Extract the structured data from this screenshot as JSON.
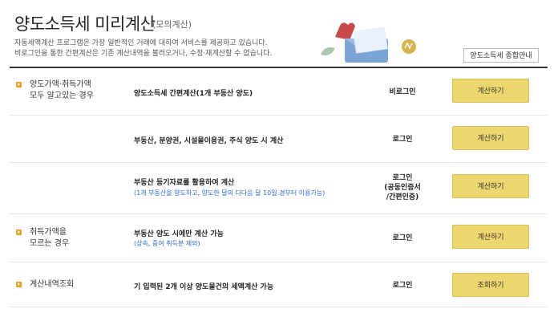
{
  "header": {
    "title": "양도소득세 미리계산",
    "subtitle": "(모의계산)",
    "desc_line1": "자동세액계산 프로그램은 가장 일반적인 거래에 대하여 서비스를 제공하고 있습니다.",
    "desc_line2": "비로그인을 통한 간편계산은 기존 계산내역을 불러오거나, 수정·재계산할 수 없습니다.",
    "overview_button": "양도소득세 종합안내"
  },
  "rows": [
    {
      "category_line1": "양도가액·취득가액",
      "category_line2": "모두 알고있는 경우",
      "title": "양도소득세 간편계산(1개 부동산 양도)",
      "auth": "비로그인",
      "button": "계산하기"
    },
    {
      "title": "부동산, 분양권, 시설물이용권, 주식 양도 시 계산",
      "auth": "로그인",
      "button": "계산하기"
    },
    {
      "title": "부동산 등기자료를 활용하여 계산",
      "note": "(1개 부동산을 양도하고, 양도한 달의 다다음 달 10일 경부터 이용가능)",
      "auth_line1": "로그인",
      "auth_line2": "(공동인증서",
      "auth_line3": "/간편인증)",
      "button": "계산하기"
    },
    {
      "category_line1": "취득가액을",
      "category_line2": "모르는 경우",
      "title": "부동산 양도 시에만 계산 가능",
      "note": "(상속, 증여 취득분 제외)",
      "auth": "로그인",
      "button": "계산하기"
    },
    {
      "category_line1": "계산내역조회",
      "title": "기 입력된 2개 이상 양도물건의 세액계산 가능",
      "auth": "로그인",
      "button": "조회하기"
    }
  ],
  "colors": {
    "accent": "#e8a317",
    "button": "#ecd66d",
    "note": "#2b6ad1"
  }
}
